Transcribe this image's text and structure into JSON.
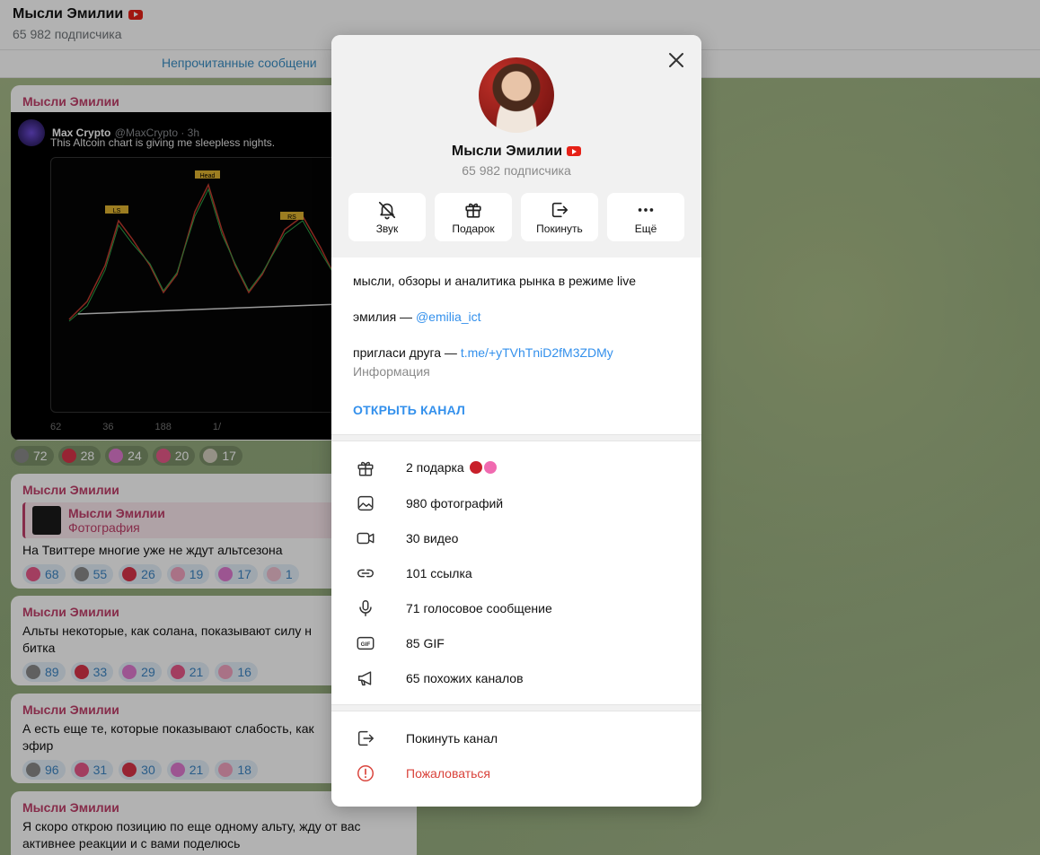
{
  "chat": {
    "title": "Мысли Эмилии",
    "subscribers": "65 982 подписчика",
    "unread_label": "Непрочитанные сообщени"
  },
  "messages": [
    {
      "author": "Мысли Эмилии",
      "tweet": {
        "name": "Max Crypto",
        "handle": "@MaxCrypto · 3h",
        "text": "This Altcoin chart is giving me sleepless nights.",
        "chart_labels": [
          "LS",
          "Head",
          "RS"
        ],
        "stats": [
          "62",
          "36",
          "188",
          "1/"
        ]
      },
      "reactions": [
        "72",
        "28",
        "24",
        "20",
        "17"
      ]
    },
    {
      "author": "Мысли Эмилии",
      "quote_author": "Мысли Эмилии",
      "quote_type": "Фотография",
      "text": "На Твиттере многие уже не ждут альтсезона",
      "reactions": [
        "68",
        "55",
        "26",
        "19",
        "17",
        "1"
      ]
    },
    {
      "author": "Мысли Эмилии",
      "text": "Альты некоторые, как солана, показывают силу н",
      "text2": "битка",
      "reactions": [
        "89",
        "33",
        "29",
        "21",
        "16"
      ]
    },
    {
      "author": "Мысли Эмилии",
      "text": "А есть еще те, которые показывают слабость, как",
      "text2": "эфир",
      "reactions": [
        "96",
        "31",
        "30",
        "21",
        "18"
      ]
    },
    {
      "author": "Мысли Эмилии",
      "text": "Я скоро открою позицию по еще одному альту, жду от вас",
      "text2": "активнее реакции и с вами поделюсь"
    }
  ],
  "modal": {
    "title": "Мысли Эмилии",
    "subscribers": "65 982 подписчика",
    "actions": [
      {
        "label": "Звук",
        "icon": "bell-off-icon"
      },
      {
        "label": "Подарок",
        "icon": "gift-icon"
      },
      {
        "label": "Покинуть",
        "icon": "leave-icon"
      },
      {
        "label": "Ещё",
        "icon": "more-icon"
      }
    ],
    "description": "мысли, обзоры и аналитика рынка в режиме live",
    "author_prefix": "эмилия — ",
    "author_link": "@emilia_ict",
    "invite_prefix": "пригласи друга — ",
    "invite_link": "t.me/+yTVhTniD2fM3ZDMy",
    "info_label": "Информация",
    "open_channel": "ОТКРЫТЬ КАНАЛ",
    "media": [
      {
        "label": "2 подарка",
        "icon": "gift-icon"
      },
      {
        "label": "980 фотографий",
        "icon": "photo-icon"
      },
      {
        "label": "30 видео",
        "icon": "video-icon"
      },
      {
        "label": "101 ссылка",
        "icon": "link-icon"
      },
      {
        "label": "71 голосовое сообщение",
        "icon": "mic-icon"
      },
      {
        "label": "85 GIF",
        "icon": "gif-icon"
      },
      {
        "label": "65 похожих каналов",
        "icon": "megaphone-icon"
      }
    ],
    "leave_channel": "Покинуть канал",
    "report": "Пожаловаться",
    "colors": {
      "accent": "#3390ec",
      "danger": "#d9423a",
      "author": "#c0406a"
    }
  }
}
